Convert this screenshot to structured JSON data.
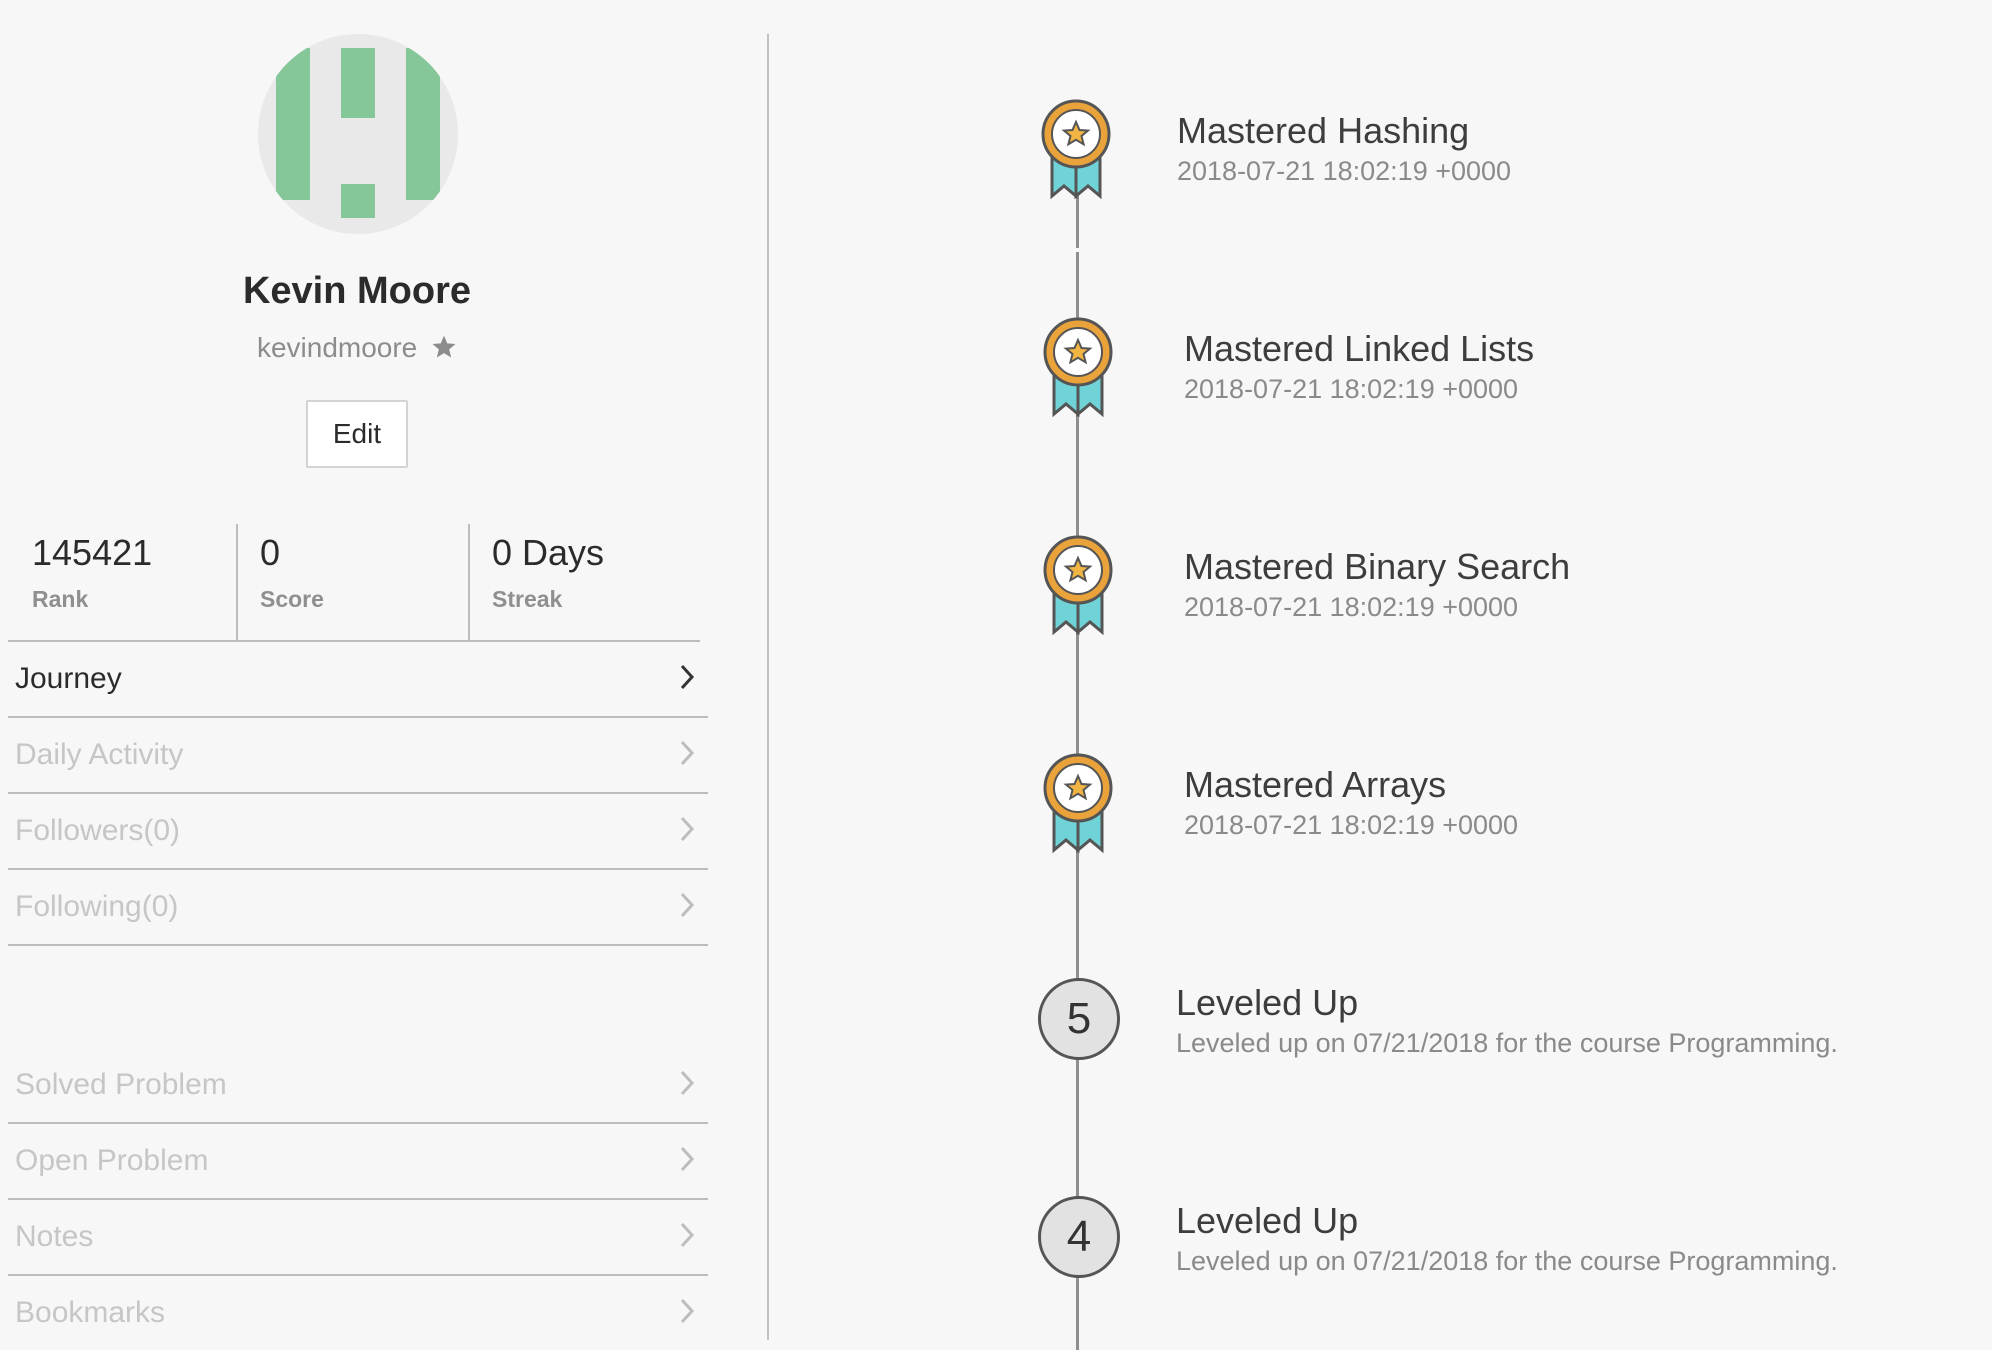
{
  "profile": {
    "name": "Kevin Moore",
    "username": "kevindmoore",
    "edit_label": "Edit",
    "avatar_color": "#86c79a"
  },
  "stats": [
    {
      "value": "145421",
      "label": "Rank"
    },
    {
      "value": "0",
      "label": "Score"
    },
    {
      "value": "0 Days",
      "label": "Streak"
    }
  ],
  "menu_primary": [
    {
      "label": "Journey",
      "active": true
    },
    {
      "label": "Daily Activity",
      "active": false
    },
    {
      "label": "Followers(0)",
      "active": false
    },
    {
      "label": "Following(0)",
      "active": false
    }
  ],
  "menu_secondary": [
    {
      "label": "Solved Problem"
    },
    {
      "label": "Open Problem"
    },
    {
      "label": "Notes"
    },
    {
      "label": "Bookmarks"
    }
  ],
  "timeline": [
    {
      "type": "mastery",
      "title": "Mastered Hashing",
      "subtitle": "2018-07-21 18:02:19 +0000"
    },
    {
      "type": "mastery",
      "title": "Mastered Linked Lists",
      "subtitle": "2018-07-21 18:02:19 +0000"
    },
    {
      "type": "mastery",
      "title": "Mastered Binary Search",
      "subtitle": "2018-07-21 18:02:19 +0000"
    },
    {
      "type": "mastery",
      "title": "Mastered Arrays",
      "subtitle": "2018-07-21 18:02:19 +0000"
    },
    {
      "type": "level",
      "level": "5",
      "title": "Leveled Up",
      "subtitle": "Leveled up on 07/21/2018 for the course Programming."
    },
    {
      "type": "level",
      "level": "4",
      "title": "Leveled Up",
      "subtitle": "Leveled up on 07/21/2018 for the course Programming."
    }
  ],
  "colors": {
    "medal_gold": "#e9a33a",
    "medal_star": "#f2b544",
    "ribbon": "#6fd3d8",
    "accent_green": "#86c79a"
  }
}
